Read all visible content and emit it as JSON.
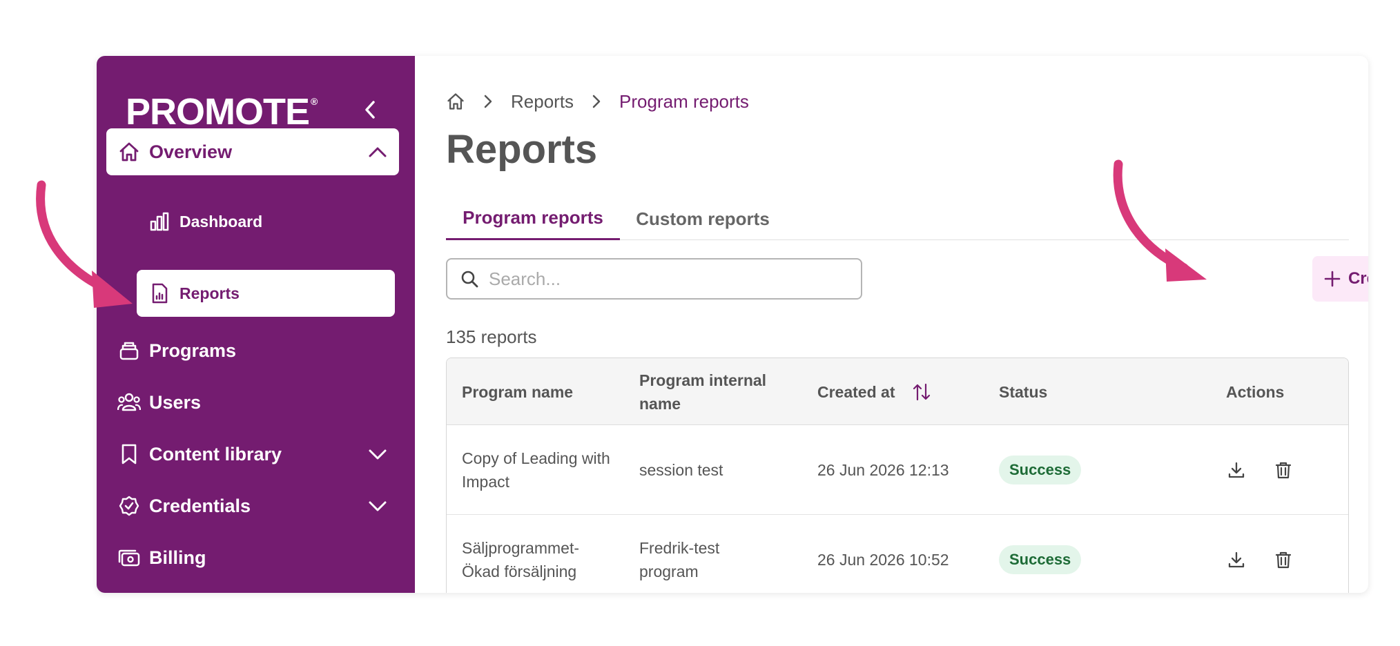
{
  "brand": {
    "logo_text": "PROMOTE",
    "logo_mark": "®",
    "color": "#741c70"
  },
  "sidebar": {
    "collapse_icon": "chevron-left-icon",
    "items": [
      {
        "label": "Overview",
        "icon": "home-icon",
        "expanded": true
      },
      {
        "label": "Dashboard",
        "icon": "bar-chart-icon"
      },
      {
        "label": "Reports",
        "icon": "report-icon",
        "active": true
      },
      {
        "label": "Programs",
        "icon": "stack-icon"
      },
      {
        "label": "Users",
        "icon": "users-icon"
      },
      {
        "label": "Content library",
        "icon": "bookmark-icon"
      },
      {
        "label": "Credentials",
        "icon": "badge-check-icon"
      },
      {
        "label": "Billing",
        "icon": "cash-icon"
      }
    ]
  },
  "breadcrumb": {
    "home_icon": "home-icon",
    "items": [
      "Reports",
      "Program reports"
    ]
  },
  "page_title": "Reports",
  "tabs": [
    {
      "label": "Program reports",
      "active": true
    },
    {
      "label": "Custom reports",
      "active": false
    }
  ],
  "search": {
    "placeholder": "Search...",
    "value": ""
  },
  "create_button": {
    "label": "Create new",
    "icon": "plus-icon"
  },
  "report_count": "135 reports",
  "table": {
    "columns": [
      "Program name",
      "Program internal name",
      "Created at",
      "Status",
      "Actions"
    ],
    "sort_icon": "sort-icon",
    "rows": [
      {
        "program_name": "Copy of Leading with Impact",
        "internal_name": "session test",
        "created_at": "26 Jun 2026 12:13",
        "status": "Success"
      },
      {
        "program_name": "Säljprogrammet-Ökad försäljning",
        "internal_name": "Fredrik-test program",
        "created_at": "26 Jun 2026 10:52",
        "status": "Success"
      }
    ]
  },
  "colors": {
    "accent": "#741c70",
    "annotation": "#d8397a",
    "success_bg": "#e3f5ea",
    "success_text": "#1d6b36",
    "create_bg": "#fce9f8"
  }
}
